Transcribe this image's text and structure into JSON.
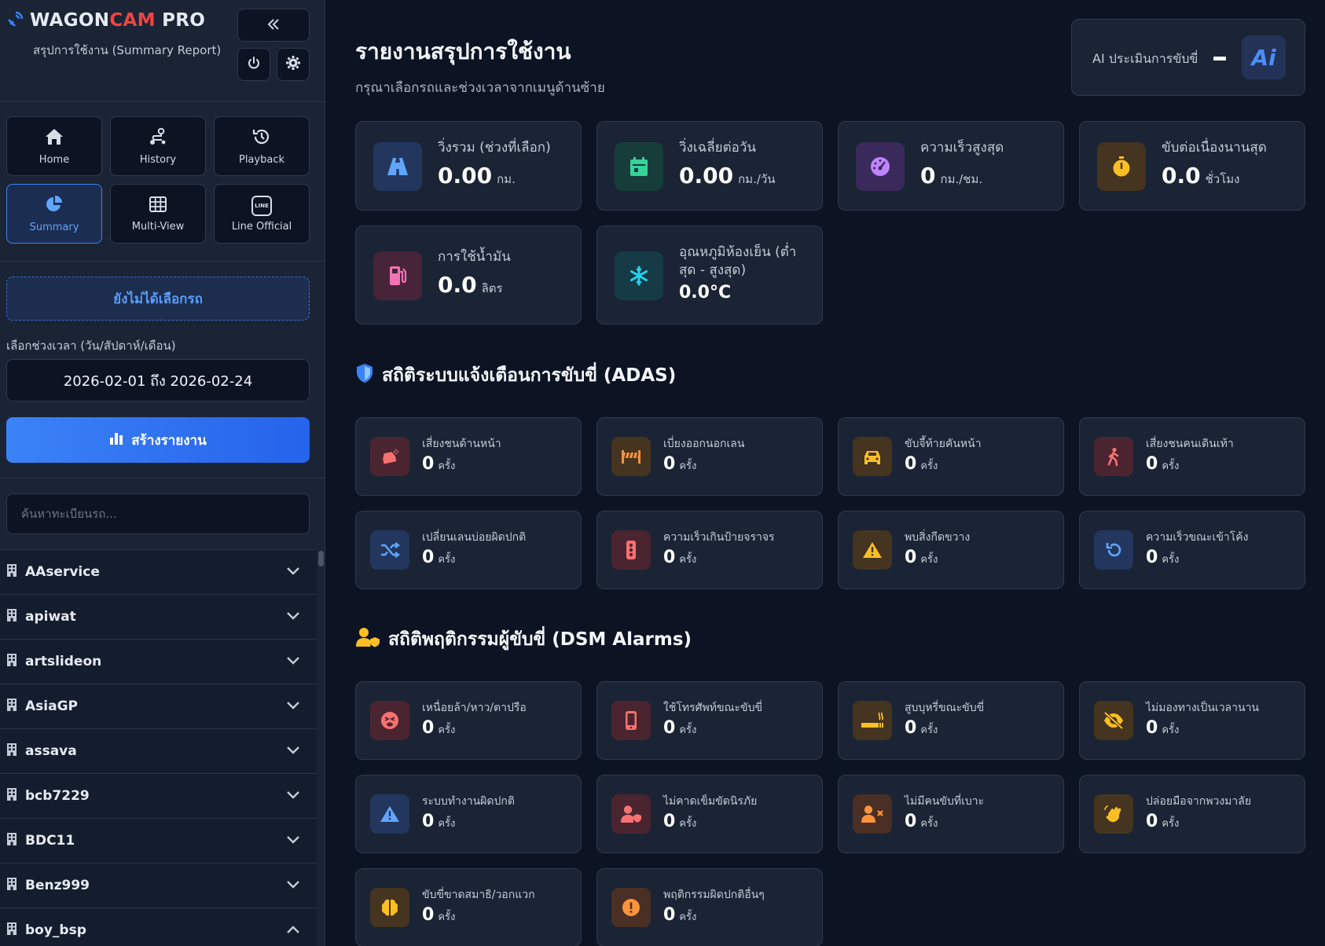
{
  "brand": {
    "name_a": "WAGON",
    "name_b": "CAM",
    "name_c": " PRO",
    "subtitle": "สรุปการใช้งาน (Summary Report)"
  },
  "nav": {
    "home": "Home",
    "history": "History",
    "playback": "Playback",
    "summary": "Summary",
    "multiview": "Multi-View",
    "line": "Line Official",
    "line_logo": "LINE"
  },
  "sidebar": {
    "vehicle_status": "ยังไม่ได้เลือกรถ",
    "range_label": "เลือกช่วงเวลา (วัน/สัปดาห์/เดือน)",
    "date_range": "2026-02-01 ถึง 2026-02-24",
    "report_button": "สร้างรายงาน",
    "search_placeholder": "ค้นหาทะเบียนรถ...",
    "groups": [
      "AAservice",
      "apiwat",
      "artslideon",
      "AsiaGP",
      "assava",
      "bcb7229",
      "BDC11",
      "Benz999",
      "boy_bsp"
    ]
  },
  "header": {
    "title": "รายงานสรุปการใช้งาน",
    "subtitle": "กรุณาเลือกรถและช่วงเวลาจากเมนูด้านซ้าย",
    "ai_label": "AI ประเมินการขับขี่",
    "ai_badge": "Ai"
  },
  "stats": [
    {
      "label": "วิ่งรวม (ช่วงที่เลือก)",
      "value": "0.00",
      "unit": "กม."
    },
    {
      "label": "วิ่งเฉลี่ยต่อวัน",
      "value": "0.00",
      "unit": "กม./วัน"
    },
    {
      "label": "ความเร็วสูงสุด",
      "value": "0",
      "unit": "กม./ชม."
    },
    {
      "label": "ขับต่อเนื่องนานสุด",
      "value": "0.0",
      "unit": "ชั่วโมง"
    },
    {
      "label": "การใช้น้ำมัน",
      "value": "0.0",
      "unit": "ลิตร"
    },
    {
      "label_1": "อุณหภูมิห้องเย็น (ต่ำ",
      "label_2": "สุด - สูงสุด)",
      "value": "0.0°C"
    }
  ],
  "adas": {
    "title": "สถิติระบบแจ้งเตือนการขับขี่ (ADAS)",
    "items": [
      {
        "label": "เสี่ยงชนด้านหน้า",
        "value": "0",
        "unit": "ครั้ง"
      },
      {
        "label": "เบี่ยงออกนอกเลน",
        "value": "0",
        "unit": "ครั้ง"
      },
      {
        "label": "ขับจี้ท้ายคันหน้า",
        "value": "0",
        "unit": "ครั้ง"
      },
      {
        "label": "เสี่ยงชนคนเดินเท้า",
        "value": "0",
        "unit": "ครั้ง"
      },
      {
        "label": "เปลี่ยนเลนบ่อยผิดปกติ",
        "value": "0",
        "unit": "ครั้ง"
      },
      {
        "label": "ความเร็วเกินป้ายจราจร",
        "value": "0",
        "unit": "ครั้ง"
      },
      {
        "label": "พบสิ่งกีดขวาง",
        "value": "0",
        "unit": "ครั้ง"
      },
      {
        "label": "ความเร็วขณะเข้าโค้ง",
        "value": "0",
        "unit": "ครั้ง"
      }
    ]
  },
  "dsm": {
    "title": "สถิติพฤติกรรมผู้ขับขี่ (DSM Alarms)",
    "items": [
      {
        "label": "เหนื่อยล้า/หาว/ตาปรือ",
        "value": "0",
        "unit": "ครั้ง"
      },
      {
        "label": "ใช้โทรศัพท์ขณะขับขี่",
        "value": "0",
        "unit": "ครั้ง"
      },
      {
        "label": "สูบบุหรี่ขณะขับขี่",
        "value": "0",
        "unit": "ครั้ง"
      },
      {
        "label": "ไม่มองทางเป็นเวลานาน",
        "value": "0",
        "unit": "ครั้ง"
      },
      {
        "label": "ระบบทำงานผิดปกติ",
        "value": "0",
        "unit": "ครั้ง"
      },
      {
        "label": "ไม่คาดเข็มขัดนิรภัย",
        "value": "0",
        "unit": "ครั้ง"
      },
      {
        "label": "ไม่มีคนขับที่เบาะ",
        "value": "0",
        "unit": "ครั้ง"
      },
      {
        "label": "ปล่อยมือจากพวงมาลัย",
        "value": "0",
        "unit": "ครั้ง"
      },
      {
        "label": "ขับขี่ขาดสมาธิ/วอกแวก",
        "value": "0",
        "unit": "ครั้ง"
      },
      {
        "label": "พฤติกรรมผิดปกติอื่นๆ",
        "value": "0",
        "unit": "ครั้ง"
      }
    ]
  },
  "icons": {
    "brand": "satellite-signal-icon",
    "collapse": "double-chevron-left-icon",
    "power": "power-icon",
    "settings": "gear-icon",
    "home": "home-icon",
    "history": "route-icon",
    "playback": "history-clock-icon",
    "summary": "pie-chart-icon",
    "multiview": "grid-icon",
    "line": "line-chat-icon",
    "report": "bar-chart-icon",
    "group": "building-icon",
    "chevron": "chevron-down-icon"
  },
  "colors": {
    "accent": "#3b82f6",
    "brand_red": "#ef4444",
    "background": "#0c1424",
    "card": "#1a2435"
  }
}
